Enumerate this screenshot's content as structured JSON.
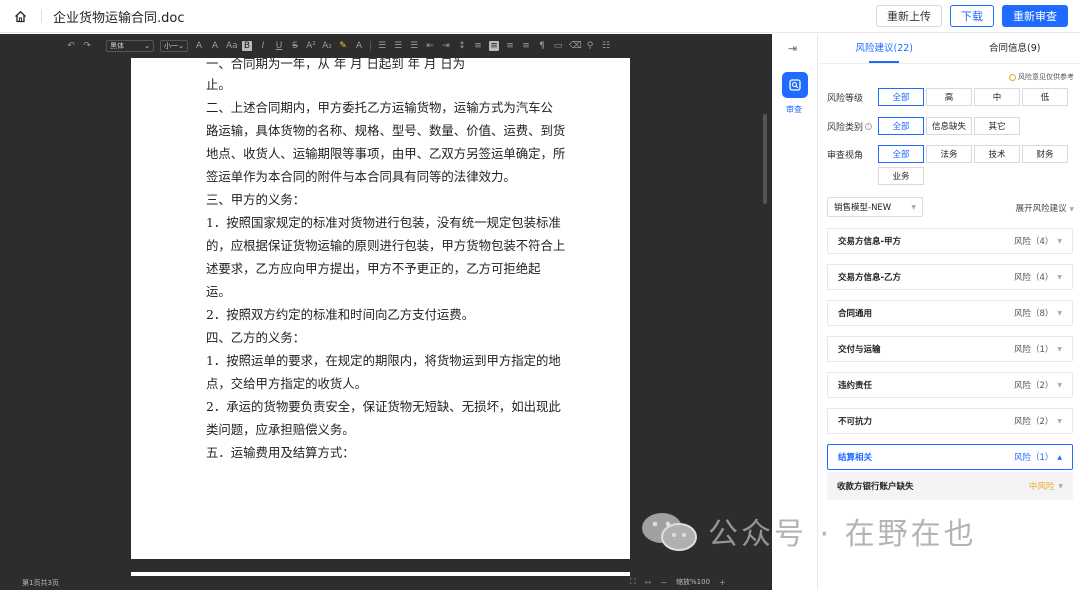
{
  "header": {
    "doc_title": "企业货物运输合同.doc",
    "buttons": {
      "reupload": "重新上传",
      "download": "下载",
      "recheck": "重新审查"
    }
  },
  "toolbar": {
    "font_name": "黑体",
    "font_size": "小一"
  },
  "document": {
    "paragraphs": [
      "一、合同期为一年，从    年   月 日起到    年   月   日为",
      "止。",
      "  二、上述合同期内，甲方委托乙方运输货物，运输方式为汽车公",
      "路运输，具体货物的名称、规格、型号、数量、价值、运费、到货",
      "地点、收货人、运输期限等事项，由甲、乙双方另签运单确定，所",
      "签运单作为本合同的附件与本合同具有同等的法律效力。",
      "  三、甲方的义务：",
      "  1．按照国家规定的标准对货物进行包装，没有统一规定包装标准",
      "的，应根据保证货物运输的原则进行包装，甲方货物包装不符合上",
      "述要求，乙方应向甲方提出，甲方不予更正的，乙方可拒绝起",
      "运。",
      "  2．按照双方约定的标准和时间向乙方支付运费。",
      "  四、乙方的义务：",
      "  1．按照运单的要求，在规定的期限内，将货物运到甲方指定的地",
      "点，交给甲方指定的收货人。",
      "  2．承运的货物要负责安全，保证货物无短缺、无损坏，如出现此",
      "类问题，应承担赔偿义务。",
      "  五．运输费用及结算方式："
    ]
  },
  "status": {
    "page_info": "第1页共3页",
    "zoom": "缩放%100"
  },
  "rail": {
    "review_label": "审查"
  },
  "panel": {
    "tabs": [
      {
        "label": "风险建议(22)"
      },
      {
        "label": "合同信息(9)"
      }
    ],
    "note": "风险意见仅供参考",
    "filters": {
      "level": {
        "label": "风险等级",
        "options": [
          "全部",
          "高",
          "中",
          "低"
        ]
      },
      "category": {
        "label": "风险类别",
        "options": [
          "全部",
          "信息缺失",
          "其它"
        ]
      },
      "perspective": {
        "label": "审查视角",
        "options": [
          "全部",
          "法务",
          "技术",
          "财务",
          "业务"
        ]
      }
    },
    "model_select": "销售模型-NEW",
    "expand_link": "展开风险建议",
    "risks": [
      {
        "name": "交易方信息-甲方",
        "count": "风险（4）"
      },
      {
        "name": "交易方信息-乙方",
        "count": "风险（4）"
      },
      {
        "name": "合同通用",
        "count": "风险（8）"
      },
      {
        "name": "交付与运输",
        "count": "风险（1）"
      },
      {
        "name": "违约责任",
        "count": "风险（2）"
      },
      {
        "name": "不可抗力",
        "count": "风险（2）"
      },
      {
        "name": "结算相关",
        "count": "风险（1）"
      }
    ],
    "sub_item": {
      "name": "收款方银行账户缺失",
      "level": "中风险"
    }
  },
  "watermark": {
    "text": "公众号 · 在野在也"
  },
  "colors": {
    "accent": "#1f6bff",
    "warning": "#f5a623",
    "editor_bg": "#2d2d2d"
  }
}
